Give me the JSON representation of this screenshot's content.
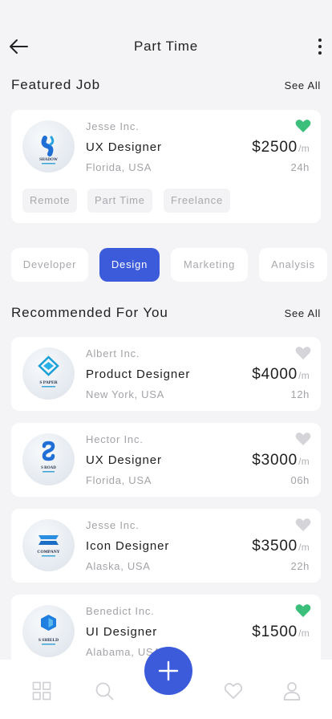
{
  "header": {
    "title": "Part Time",
    "back_icon": "arrow-left-icon",
    "more_icon": "more-vertical-icon"
  },
  "featured": {
    "heading": "Featured Job",
    "see_all": "See All",
    "job": {
      "company": "Jesse Inc.",
      "role": "UX Designer",
      "location": "Florida, USA",
      "price": "$2500",
      "unit": "/m",
      "time": "24h",
      "favorited": true,
      "logo_text": "SHADOW",
      "tags": [
        "Remote",
        "Part Time",
        "Freelance"
      ]
    }
  },
  "categories": {
    "items": [
      "Developer",
      "Design",
      "Marketing",
      "Analysis"
    ],
    "selected": "Design"
  },
  "recommended": {
    "heading": "Recommended For You",
    "see_all": "See All",
    "jobs": [
      {
        "company": "Albert Inc.",
        "role": "Product Designer",
        "location": "New York, USA",
        "price": "$4000",
        "unit": "/m",
        "time": "12h",
        "favorited": false,
        "logo_text": "S PAPER"
      },
      {
        "company": "Hector Inc.",
        "role": "UX Designer",
        "location": "Florida, USA",
        "price": "$3000",
        "unit": "/m",
        "time": "06h",
        "favorited": false,
        "logo_text": "S ROAD"
      },
      {
        "company": "Jesse Inc.",
        "role": "Icon Designer",
        "location": "Alaska, USA",
        "price": "$3500",
        "unit": "/m",
        "time": "22h",
        "favorited": false,
        "logo_text": "COMPANY"
      },
      {
        "company": "Benedict Inc.",
        "role": "UI Designer",
        "location": "Alabama, USA",
        "price": "$1500",
        "unit": "/m",
        "time": "",
        "favorited": true,
        "logo_text": "S SHIELD"
      }
    ]
  },
  "bottom_nav": {
    "items": [
      "grid-icon",
      "search-icon",
      "heart-icon",
      "user-icon"
    ],
    "fab_icon": "plus-icon"
  },
  "colors": {
    "accent": "#3b5bdb",
    "favorite": "#3dbf7c",
    "heart_inactive": "#d5d5d9",
    "background": "#f4f4f6"
  }
}
